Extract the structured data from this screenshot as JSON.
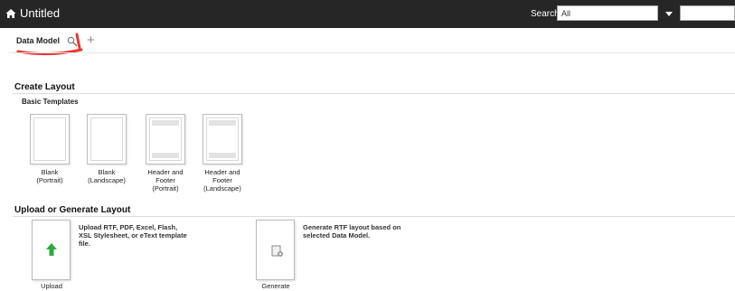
{
  "app": {
    "title": "Untitled"
  },
  "search": {
    "label": "Search",
    "scope": "All"
  },
  "tabs": {
    "data_model": "Data Model"
  },
  "colors": {
    "topbar": "#262626",
    "annotation": "#e53935",
    "upload_arrow": "#2eaa3e"
  },
  "create_layout": {
    "title": "Create Layout",
    "subtitle": "Basic Templates",
    "templates": [
      {
        "label": "Blank\n(Portrait)",
        "kind": "blank-portrait"
      },
      {
        "label": "Blank\n(Landscape)",
        "kind": "blank-landscape"
      },
      {
        "label": "Header and\nFooter\n(Portrait)",
        "kind": "header-footer-portrait"
      },
      {
        "label": "Header and\nFooter\n(Landscape)",
        "kind": "header-footer-landscape"
      }
    ]
  },
  "upload_generate": {
    "title": "Upload or Generate Layout",
    "upload": {
      "desc": "Upload RTF, PDF, Excel, Flash, XSL Stylesheet, or eText template file.",
      "label": "Upload",
      "icon": "up-arrow-icon"
    },
    "generate": {
      "desc": "Generate RTF layout based on selected Data Model.",
      "label": "Generate",
      "icon": "generate-doc-icon"
    }
  }
}
